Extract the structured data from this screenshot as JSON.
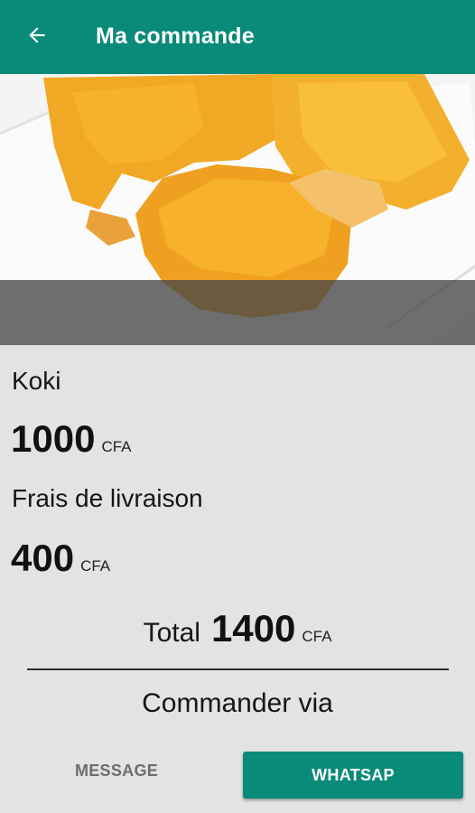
{
  "appbar": {
    "title": "Ma commande",
    "back_icon": "arrow-left-icon",
    "color": "#0a8a78"
  },
  "product": {
    "name": "Koki",
    "price": "1000",
    "currency": "CFA"
  },
  "delivery": {
    "label": "Frais de livraison",
    "price": "400",
    "currency": "CFA"
  },
  "total": {
    "label": "Total",
    "value": "1400",
    "currency": "CFA"
  },
  "order": {
    "via_label": "Commander via",
    "message_button": "MESSAGE",
    "whatsapp_button": "WHATSAP"
  },
  "colors": {
    "accent": "#0a8a78",
    "background": "#e3e3e3",
    "image_overlay": "rgba(70,70,70,0.75)"
  }
}
